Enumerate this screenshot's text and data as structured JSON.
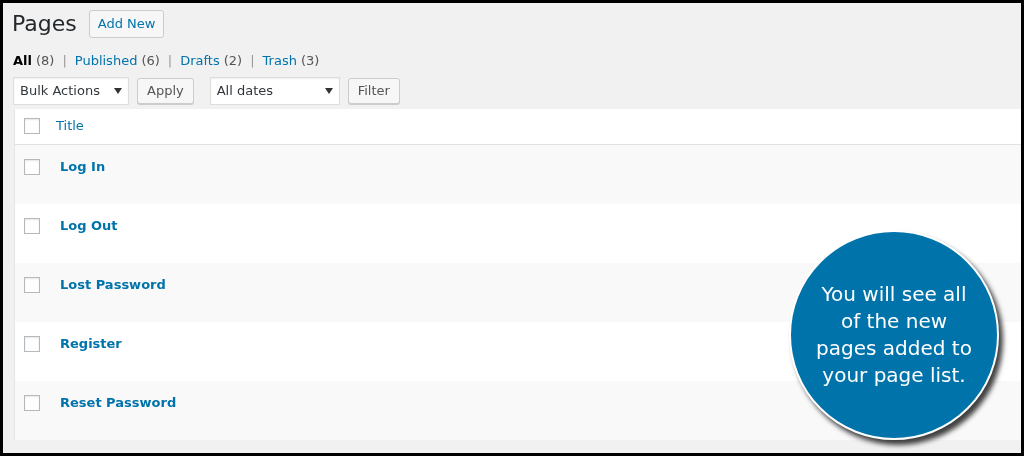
{
  "page_title": "Pages",
  "add_new_button": "Add New",
  "filters": [
    {
      "label": "All",
      "count": "(8)",
      "selected": true
    },
    {
      "label": "Published",
      "count": "(6)",
      "selected": false
    },
    {
      "label": "Drafts",
      "count": "(2)",
      "selected": false
    },
    {
      "label": "Trash",
      "count": "(3)",
      "selected": false
    }
  ],
  "separator": "|",
  "bulk_actions": {
    "value": "Bulk Actions",
    "button": "Apply"
  },
  "date_filter": {
    "value": "All dates",
    "button": "Filter"
  },
  "table": {
    "columns": [
      {
        "label": "Title"
      }
    ],
    "select_all_checked": false,
    "rows": [
      {
        "title": "Log In",
        "checked": false
      },
      {
        "title": "Log Out",
        "checked": false
      },
      {
        "title": "Lost Password",
        "checked": false
      },
      {
        "title": "Register",
        "checked": false
      },
      {
        "title": "Reset Password",
        "checked": false
      }
    ]
  },
  "callout": {
    "text": "You will see all of the new pages added to your page list."
  }
}
